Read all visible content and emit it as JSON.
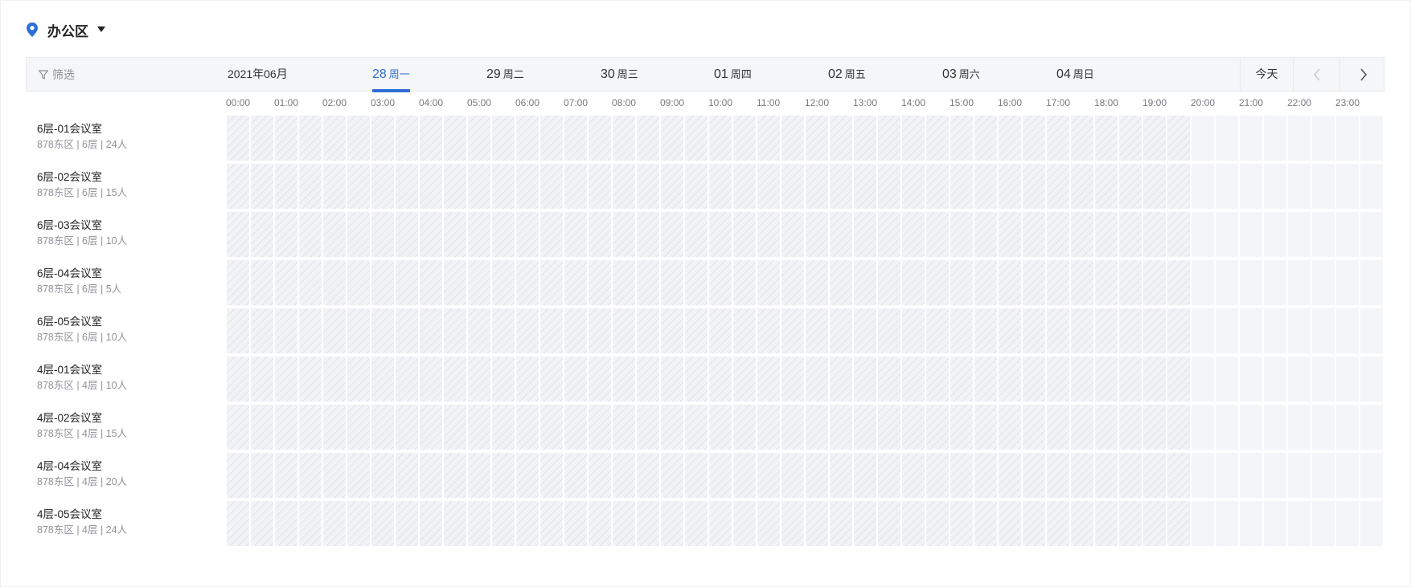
{
  "location": {
    "label": "办公区"
  },
  "header": {
    "filter_label": "筛选",
    "month_label": "2021年06月",
    "days": [
      {
        "num": "28",
        "week": "周一",
        "active": true
      },
      {
        "num": "29",
        "week": "周二",
        "active": false
      },
      {
        "num": "30",
        "week": "周三",
        "active": false
      },
      {
        "num": "01",
        "week": "周四",
        "active": false
      },
      {
        "num": "02",
        "week": "周五",
        "active": false
      },
      {
        "num": "03",
        "week": "周六",
        "active": false
      },
      {
        "num": "04",
        "week": "周日",
        "active": false
      }
    ],
    "today_label": "今天"
  },
  "hours": [
    "00:00",
    "01:00",
    "02:00",
    "03:00",
    "04:00",
    "05:00",
    "06:00",
    "07:00",
    "08:00",
    "09:00",
    "10:00",
    "11:00",
    "12:00",
    "13:00",
    "14:00",
    "15:00",
    "16:00",
    "17:00",
    "18:00",
    "19:00",
    "20:00",
    "21:00",
    "22:00",
    "23:00"
  ],
  "rooms": [
    {
      "name": "6层-01会议室",
      "detail": "878东区 | 6层 | 24人"
    },
    {
      "name": "6层-02会议室",
      "detail": "878东区 | 6层 | 15人"
    },
    {
      "name": "6层-03会议室",
      "detail": "878东区 | 6层 | 10人"
    },
    {
      "name": "6层-04会议室",
      "detail": "878东区 | 6层 | 5人"
    },
    {
      "name": "6层-05会议室",
      "detail": "878东区 | 6层 | 10人"
    },
    {
      "name": "4层-01会议室",
      "detail": "878东区 | 4层 | 10人"
    },
    {
      "name": "4层-02会议室",
      "detail": "878东区 | 4层 | 15人"
    },
    {
      "name": "4层-04会议室",
      "detail": "878东区 | 4层 | 20人"
    },
    {
      "name": "4层-05会议室",
      "detail": "878东区 | 4层 | 24人"
    }
  ],
  "schedule": {
    "slots_per_hour": 2,
    "past_slots": 40
  },
  "colors": {
    "accent": "#2f6fd6",
    "past_cell": "#f2f3f6",
    "free_cell": "#f4f5f8",
    "header_bg": "#f5f6f8"
  },
  "icons": {
    "location": "map-pin-icon",
    "dropdown": "caret-down-icon",
    "filter": "filter-icon",
    "prev": "chevron-left-icon",
    "next": "chevron-right-icon"
  }
}
